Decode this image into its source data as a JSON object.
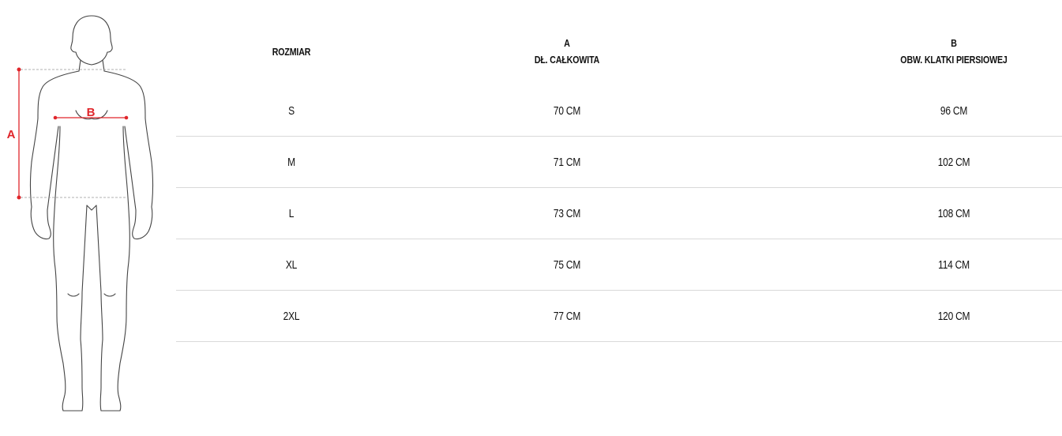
{
  "figure": {
    "label_a": "A",
    "label_b": "B",
    "accent_color": "#e0262b"
  },
  "table": {
    "headers": {
      "size": "ROZMIAR",
      "a_letter": "A",
      "a_label": "DŁ. CAŁKOWITA",
      "b_letter": "B",
      "b_label": "OBW. KLATKI PIERSIOWEJ"
    },
    "rows": [
      {
        "size": "S",
        "a": "70 CM",
        "b": "96 CM"
      },
      {
        "size": "M",
        "a": "71 CM",
        "b": "102 CM"
      },
      {
        "size": "L",
        "a": "73 CM",
        "b": "108 CM"
      },
      {
        "size": "XL",
        "a": "75 CM",
        "b": "114 CM"
      },
      {
        "size": "2XL",
        "a": "77 CM",
        "b": "120 CM"
      }
    ]
  }
}
